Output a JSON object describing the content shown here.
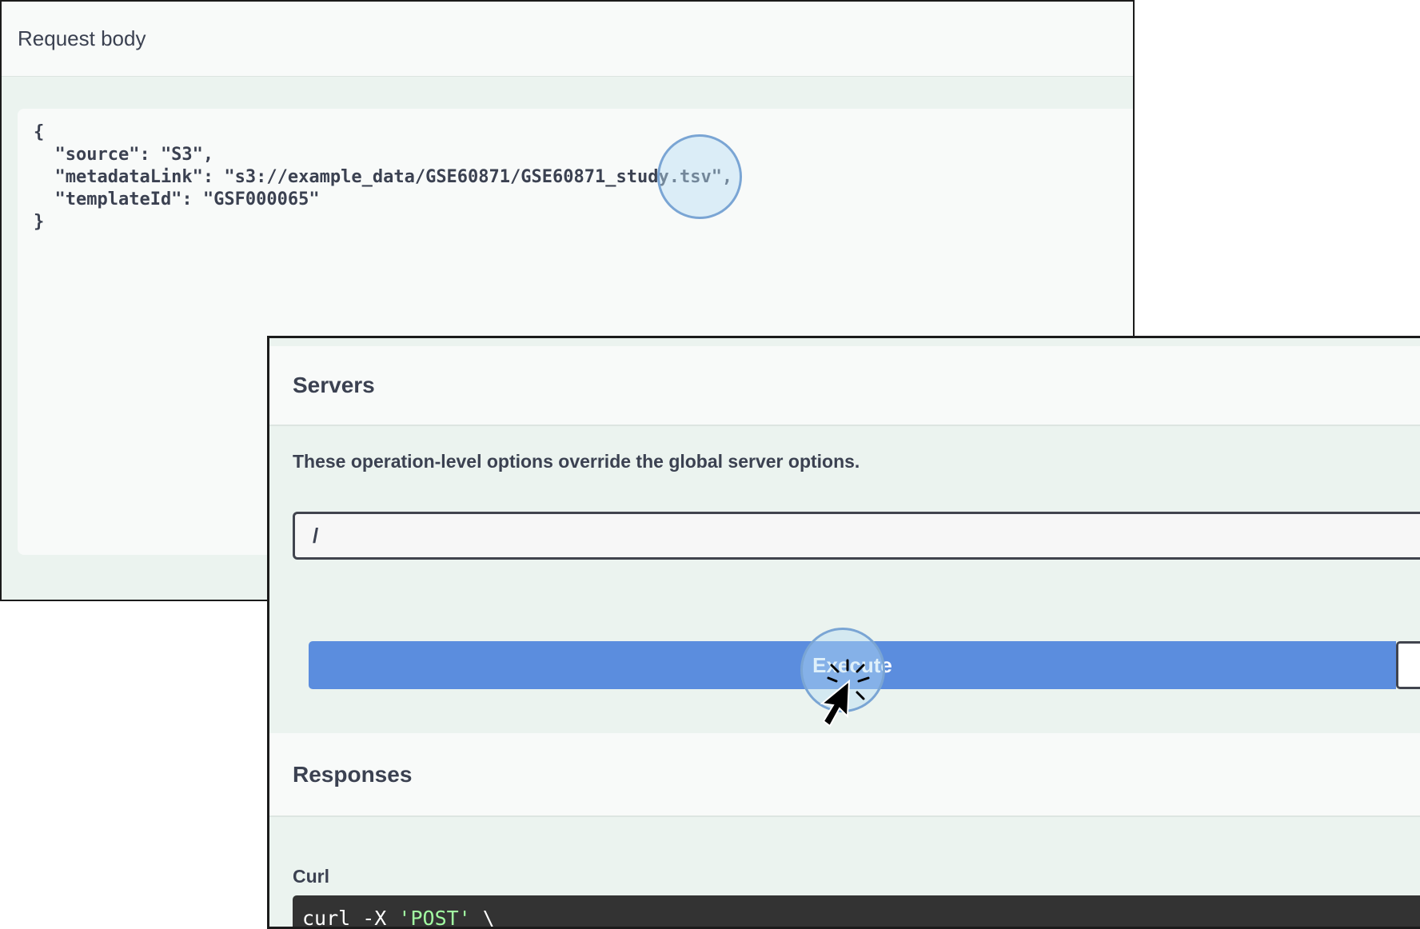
{
  "request_body": {
    "title": "Request body",
    "code_lines": [
      "{",
      "  \"source\": \"S3\",",
      "  \"metadataLink\": \"s3://example_data/GSE60871/GSE60871_study.tsv\",",
      "  \"templateId\": \"GSF000065\"",
      "}"
    ]
  },
  "servers": {
    "title": "Servers",
    "description": "These operation-level options override the global server options.",
    "selected_value": "/"
  },
  "execute": {
    "label": "Execute"
  },
  "responses": {
    "title": "Responses",
    "curl_label": "Curl",
    "curl_cmd": "curl -X ",
    "curl_method": "'POST'",
    "curl_tail": " \\"
  },
  "colors": {
    "execute_button": "#5b8dde",
    "panel_background": "#ebf3ef",
    "section_header": "#f8faf9",
    "curl_background": "#333333",
    "curl_string": "#a2fca2",
    "click_ring": "#7aa5d4"
  },
  "icons": {
    "cursor": "pointer-click-icon"
  }
}
